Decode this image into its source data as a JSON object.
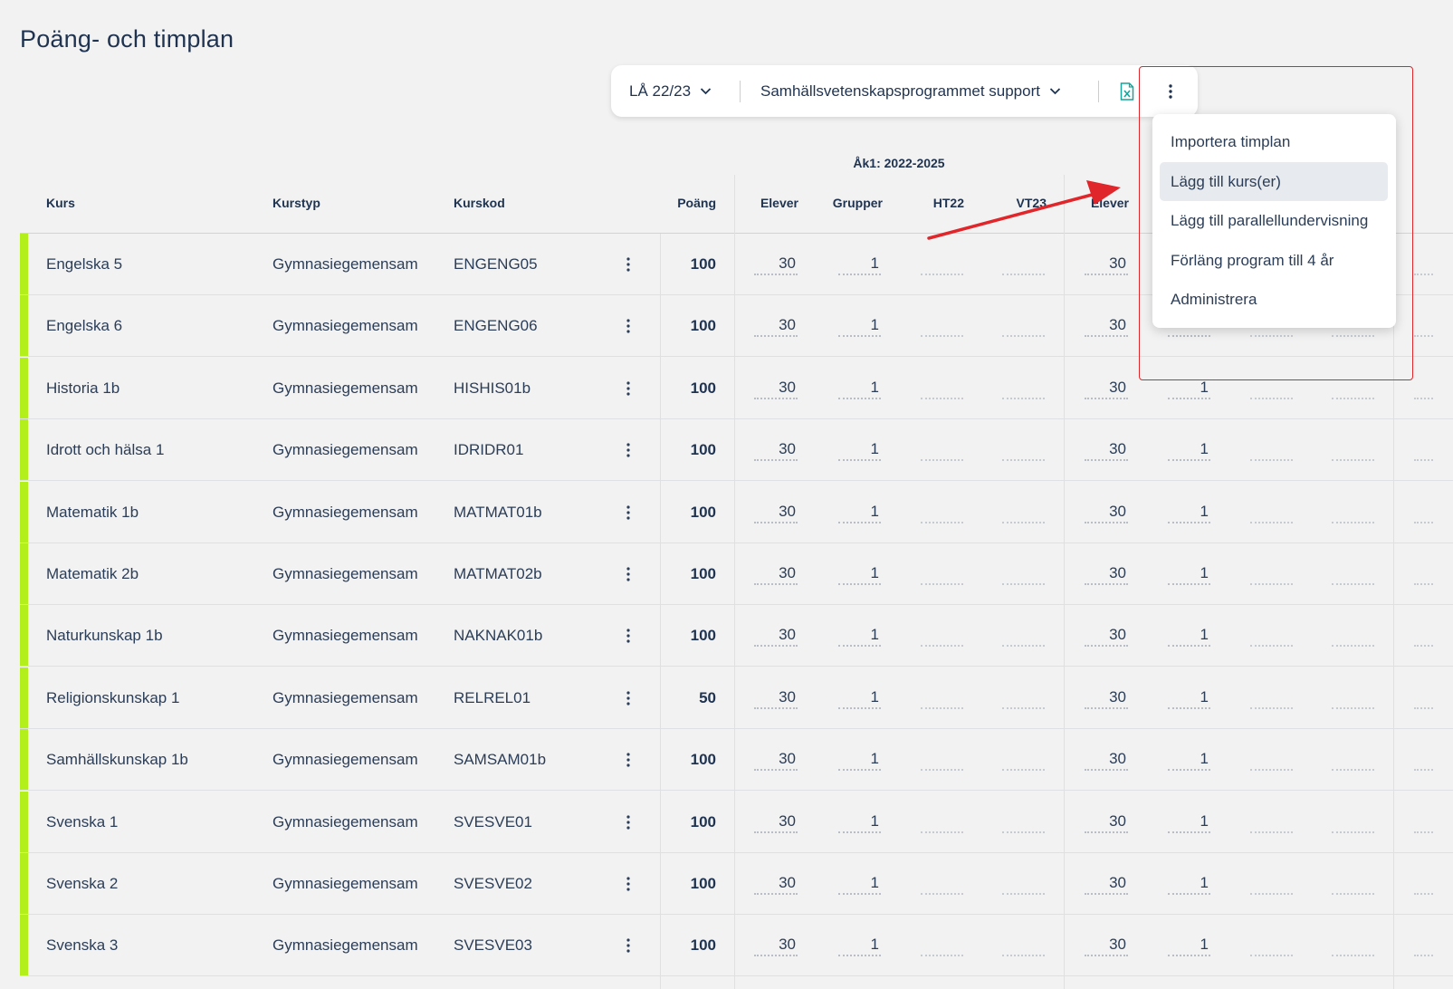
{
  "page_title": "Poäng- och timplan",
  "toolbar": {
    "year_label": "LÅ 22/23",
    "program_label": "Samhällsvetenskapsprogrammet support"
  },
  "menu": {
    "items": [
      "Importera timplan",
      "Lägg till kurs(er)",
      "Lägg till parallellundervisning",
      "Förläng program till 4 år",
      "Administrera"
    ],
    "highlighted_index": 1
  },
  "table": {
    "group_header": "Åk1: 2022-2025",
    "headers": {
      "kurs": "Kurs",
      "kurstyp": "Kurstyp",
      "kurskod": "Kurskod",
      "poang": "Poäng",
      "elever": "Elever",
      "grupper": "Grupper",
      "ht22": "HT22",
      "vt23": "VT23",
      "elever2": "Elever"
    },
    "rows": [
      {
        "kurs": "Engelska 5",
        "kurstyp": "Gymnasiegemensam",
        "kurskod": "ENGENG05",
        "poang": "100",
        "elever": "30",
        "grupper": "1",
        "elever2": "30",
        "grupper2": ""
      },
      {
        "kurs": "Engelska 6",
        "kurstyp": "Gymnasiegemensam",
        "kurskod": "ENGENG06",
        "poang": "100",
        "elever": "30",
        "grupper": "1",
        "elever2": "30",
        "grupper2": ""
      },
      {
        "kurs": "Historia 1b",
        "kurstyp": "Gymnasiegemensam",
        "kurskod": "HISHIS01b",
        "poang": "100",
        "elever": "30",
        "grupper": "1",
        "elever2": "30",
        "grupper2": "1"
      },
      {
        "kurs": "Idrott och hälsa 1",
        "kurstyp": "Gymnasiegemensam",
        "kurskod": "IDRIDR01",
        "poang": "100",
        "elever": "30",
        "grupper": "1",
        "elever2": "30",
        "grupper2": "1"
      },
      {
        "kurs": "Matematik 1b",
        "kurstyp": "Gymnasiegemensam",
        "kurskod": "MATMAT01b",
        "poang": "100",
        "elever": "30",
        "grupper": "1",
        "elever2": "30",
        "grupper2": "1"
      },
      {
        "kurs": "Matematik 2b",
        "kurstyp": "Gymnasiegemensam",
        "kurskod": "MATMAT02b",
        "poang": "100",
        "elever": "30",
        "grupper": "1",
        "elever2": "30",
        "grupper2": "1"
      },
      {
        "kurs": "Naturkunskap 1b",
        "kurstyp": "Gymnasiegemensam",
        "kurskod": "NAKNAK01b",
        "poang": "100",
        "elever": "30",
        "grupper": "1",
        "elever2": "30",
        "grupper2": "1"
      },
      {
        "kurs": "Religionskunskap 1",
        "kurstyp": "Gymnasiegemensam",
        "kurskod": "RELREL01",
        "poang": "50",
        "elever": "30",
        "grupper": "1",
        "elever2": "30",
        "grupper2": "1"
      },
      {
        "kurs": "Samhällskunskap 1b",
        "kurstyp": "Gymnasiegemensam",
        "kurskod": "SAMSAM01b",
        "poang": "100",
        "elever": "30",
        "grupper": "1",
        "elever2": "30",
        "grupper2": "1"
      },
      {
        "kurs": "Svenska 1",
        "kurstyp": "Gymnasiegemensam",
        "kurskod": "SVESVE01",
        "poang": "100",
        "elever": "30",
        "grupper": "1",
        "elever2": "30",
        "grupper2": "1"
      },
      {
        "kurs": "Svenska 2",
        "kurstyp": "Gymnasiegemensam",
        "kurskod": "SVESVE02",
        "poang": "100",
        "elever": "30",
        "grupper": "1",
        "elever2": "30",
        "grupper2": "1"
      },
      {
        "kurs": "Svenska 3",
        "kurstyp": "Gymnasiegemensam",
        "kurskod": "SVESVE03",
        "poang": "100",
        "elever": "30",
        "grupper": "1",
        "elever2": "30",
        "grupper2": "1"
      }
    ]
  },
  "colors": {
    "accent_bar": "#b3ef1a",
    "text": "#1f3350",
    "annotation_red": "#e0262a",
    "excel_icon": "#1aa39a"
  },
  "icons": {
    "excel": "excel-export-icon",
    "more": "more-vertical-icon",
    "chevron": "chevron-down-icon"
  }
}
